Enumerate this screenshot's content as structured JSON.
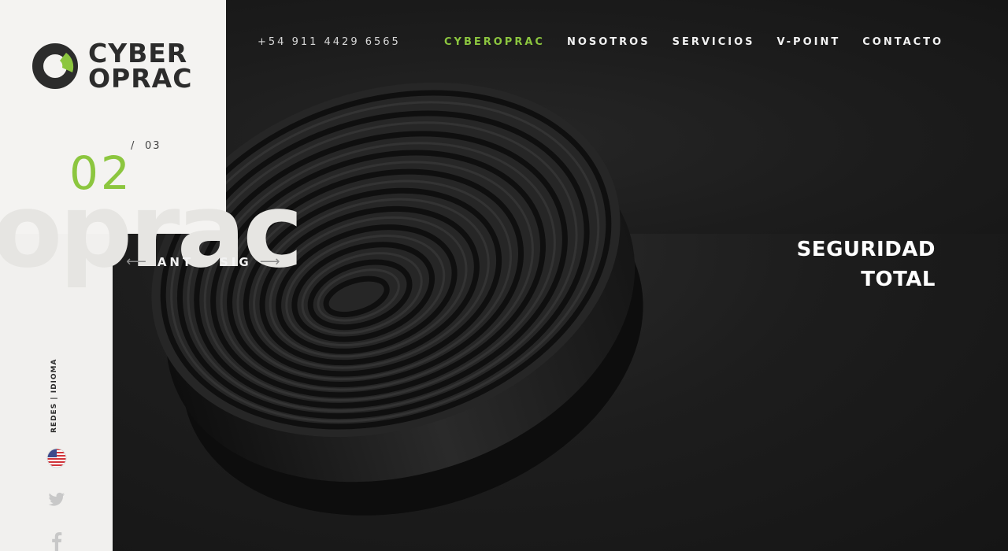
{
  "brand": {
    "line1": "CYBER",
    "line2": "OPRAC",
    "watermark": "oprac",
    "accent": "#8cc63f"
  },
  "slider": {
    "current": "02",
    "separator": "/",
    "total": "03",
    "prev_label": "ANT",
    "next_label": "SIG",
    "headline_line1": "SEGURIDAD",
    "headline_line2": "TOTAL"
  },
  "header": {
    "phone": "+54 911 4429 6565",
    "nav": [
      {
        "label": "CYBEROPRAC",
        "active": true
      },
      {
        "label": "NOSOTROS",
        "active": false
      },
      {
        "label": "SERVICIOS",
        "active": false
      },
      {
        "label": "V-POINT",
        "active": false
      },
      {
        "label": "CONTACTO",
        "active": false
      }
    ]
  },
  "side": {
    "label": "REDES | IDIOMA",
    "icons": [
      "us-flag-icon",
      "twitter-icon",
      "facebook-icon"
    ]
  }
}
